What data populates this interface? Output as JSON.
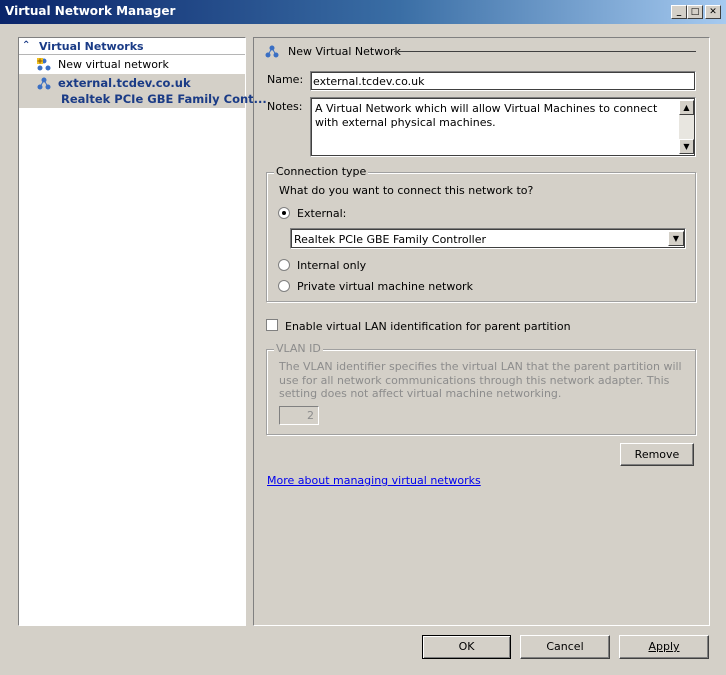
{
  "window": {
    "title": "Virtual Network Manager",
    "minimize": "_",
    "maximize": "□",
    "close": "✕"
  },
  "tree": {
    "header": "Virtual Networks",
    "new_item": "New virtual network",
    "selected_network": "external.tcdev.co.uk",
    "selected_adapter": "Realtek PCIe GBE Family Cont..."
  },
  "form": {
    "section_title": "New Virtual Network",
    "name_label": "Name:",
    "name_value": "external.tcdev.co.uk",
    "notes_label": "Notes:",
    "notes_value": "A Virtual Network which will allow Virtual Machines to connect with external physical machines.",
    "connection_type": {
      "legend": "Connection type",
      "question": "What do you want to connect this network to?",
      "external_label": "External:",
      "external_selected": true,
      "adapter_value": "Realtek PCIe GBE Family Controller",
      "internal_label": "Internal only",
      "private_label": "Private virtual machine network"
    },
    "vlan_checkbox_label": "Enable virtual LAN identification for parent partition",
    "vlan_checked": false,
    "vlan": {
      "legend": "VLAN ID",
      "description": "The VLAN identifier specifies the virtual LAN that the parent partition will use for all network communications through this network adapter. This setting does not affect virtual machine networking.",
      "value": "2"
    },
    "remove_button": "Remove",
    "help_link": "More about managing virtual networks"
  },
  "footer": {
    "ok": "OK",
    "cancel": "Cancel",
    "apply": "Apply"
  }
}
